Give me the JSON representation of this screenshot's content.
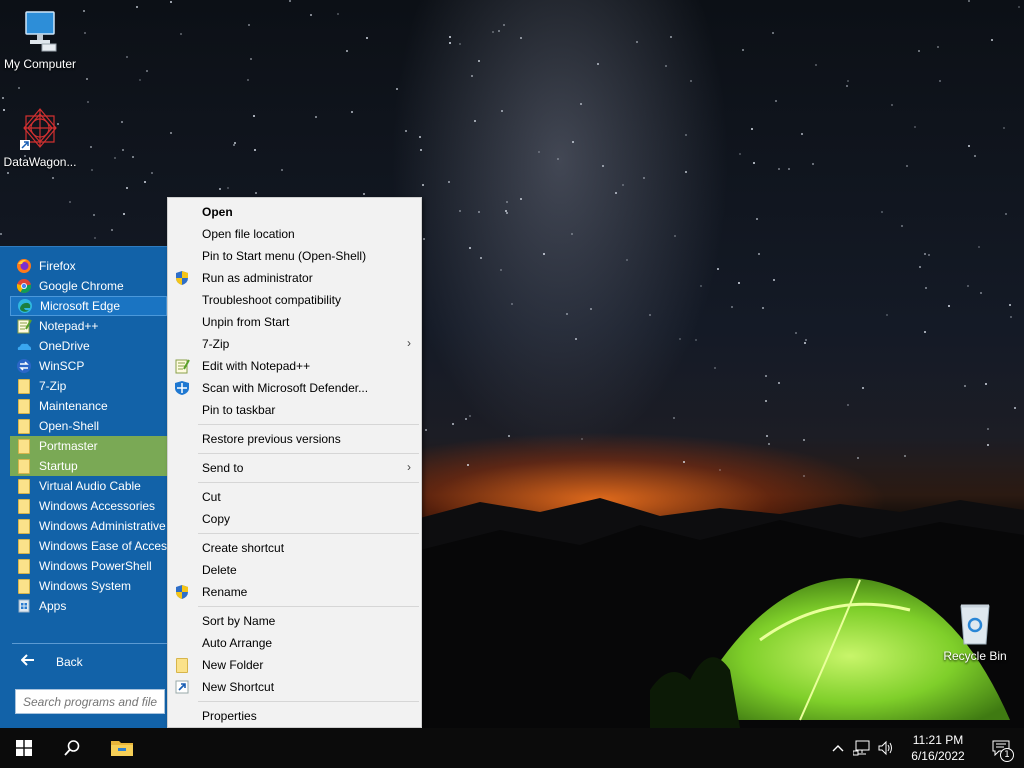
{
  "desktop": {
    "icons": [
      {
        "label": "My Computer",
        "icon": "computer-icon"
      },
      {
        "label": "DataWagon...",
        "icon": "shortcut-icon"
      },
      {
        "label": "Recycle Bin",
        "icon": "recycle-bin-icon"
      }
    ]
  },
  "start_menu": {
    "programs": [
      {
        "label": "Firefox",
        "icon": "firefox-icon"
      },
      {
        "label": "Google Chrome",
        "icon": "chrome-icon"
      },
      {
        "label": "Microsoft Edge",
        "icon": "edge-icon"
      },
      {
        "label": "Notepad++",
        "icon": "notepadpp-icon"
      },
      {
        "label": "OneDrive",
        "icon": "onedrive-icon"
      },
      {
        "label": "WinSCP",
        "icon": "winscp-icon"
      },
      {
        "label": "7-Zip",
        "icon": "folder-icon"
      },
      {
        "label": "Maintenance",
        "icon": "folder-icon"
      },
      {
        "label": "Open-Shell",
        "icon": "folder-icon"
      },
      {
        "label": "Portmaster",
        "icon": "folder-icon"
      },
      {
        "label": "Startup",
        "icon": "folder-icon"
      },
      {
        "label": "Virtual Audio Cable",
        "icon": "folder-icon"
      },
      {
        "label": "Windows Accessories",
        "icon": "folder-icon"
      },
      {
        "label": "Windows Administrative Tools",
        "icon": "folder-icon"
      },
      {
        "label": "Windows Ease of Access",
        "icon": "folder-icon"
      },
      {
        "label": "Windows PowerShell",
        "icon": "folder-icon"
      },
      {
        "label": "Windows System",
        "icon": "folder-icon"
      },
      {
        "label": "Apps",
        "icon": "apps-icon"
      }
    ],
    "back_label": "Back",
    "search_placeholder": "Search programs and files",
    "colors": {
      "background": "#1262a8",
      "highlight": "#7aa955"
    }
  },
  "context_menu": {
    "items": [
      {
        "label": "Open",
        "bold": true
      },
      {
        "label": "Open file location"
      },
      {
        "label": "Pin to Start menu (Open-Shell)"
      },
      {
        "label": "Run as administrator",
        "icon": "shield-icon"
      },
      {
        "label": "Troubleshoot compatibility"
      },
      {
        "label": "Unpin from Start"
      },
      {
        "label": "7-Zip",
        "submenu": true
      },
      {
        "label": "Edit with Notepad++",
        "icon": "notepadpp-icon"
      },
      {
        "label": "Scan with Microsoft Defender...",
        "icon": "defender-icon"
      },
      {
        "label": "Pin to taskbar"
      },
      {
        "separator": true
      },
      {
        "label": "Restore previous versions"
      },
      {
        "separator": true
      },
      {
        "label": "Send to",
        "submenu": true
      },
      {
        "separator": true
      },
      {
        "label": "Cut"
      },
      {
        "label": "Copy"
      },
      {
        "separator": true
      },
      {
        "label": "Create shortcut"
      },
      {
        "label": "Delete"
      },
      {
        "label": "Rename",
        "icon": "shield-icon"
      },
      {
        "separator": true
      },
      {
        "label": "Sort by Name"
      },
      {
        "label": "Auto Arrange"
      },
      {
        "label": "New Folder",
        "icon": "folder-icon"
      },
      {
        "label": "New Shortcut",
        "icon": "shortcut-arrow-icon"
      },
      {
        "separator": true
      },
      {
        "label": "Properties"
      }
    ]
  },
  "taskbar": {
    "time": "11:21 PM",
    "date": "6/16/2022",
    "notification_count": "1"
  }
}
